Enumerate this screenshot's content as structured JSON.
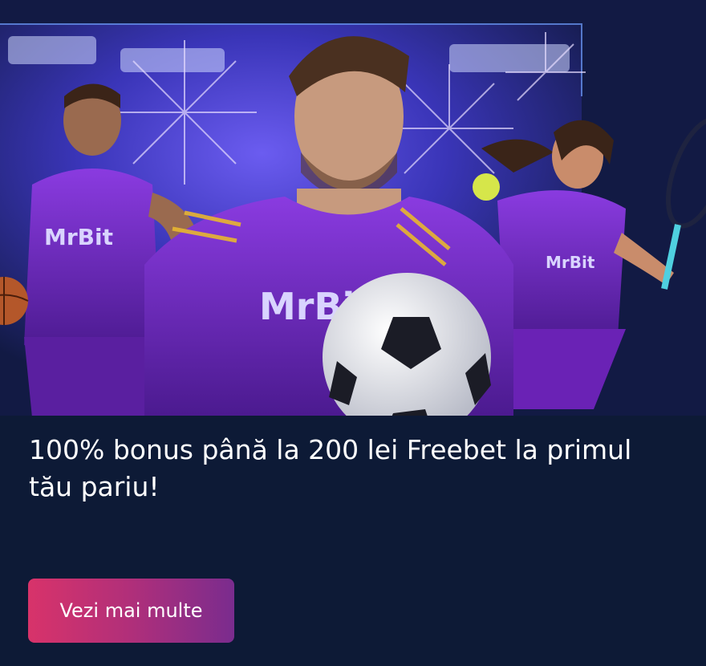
{
  "hero": {
    "brand_logo_text": "MrBit",
    "colors": {
      "card_background": "#0d1a36",
      "hero_sky": "#2a2a9e",
      "jersey_purple": "#7b2fd0",
      "cta_start": "#d8336a",
      "cta_end": "#7a2c8e"
    }
  },
  "promo": {
    "headline": "100% bonus până la 200 lei Freebet la primul tău pariu!"
  },
  "cta": {
    "label": "Vezi mai multe"
  }
}
